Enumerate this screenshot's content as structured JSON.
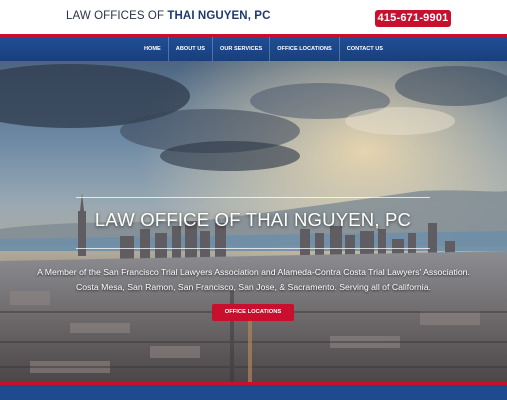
{
  "header": {
    "logo_prefix": "LAW OFFICES OF ",
    "logo_name": "THAI NGUYEN, PC",
    "phone": "415-671-9901"
  },
  "nav": {
    "items": [
      {
        "label": "HOME"
      },
      {
        "label": "ABOUT US"
      },
      {
        "label": "OUR SERVICES"
      },
      {
        "label": "OFFICE LOCATIONS"
      },
      {
        "label": "CONTACT US"
      }
    ]
  },
  "hero": {
    "title": "LAW OFFICE OF THAI NGUYEN, PC",
    "description_line1": "A Member of the San Francisco Trial Lawyers Association and Alameda-Contra Costa Trial Lawyers' Association.",
    "description_line2": "Costa Mesa, San Ramon, San Francisco, San Jose, & Sacramento. Serving all of California.",
    "cta_label": "OFFICE LOCATIONS"
  },
  "colors": {
    "accent_red": "#c8102e",
    "nav_blue": "#1f4f96",
    "logo_text": "#2b3347"
  }
}
